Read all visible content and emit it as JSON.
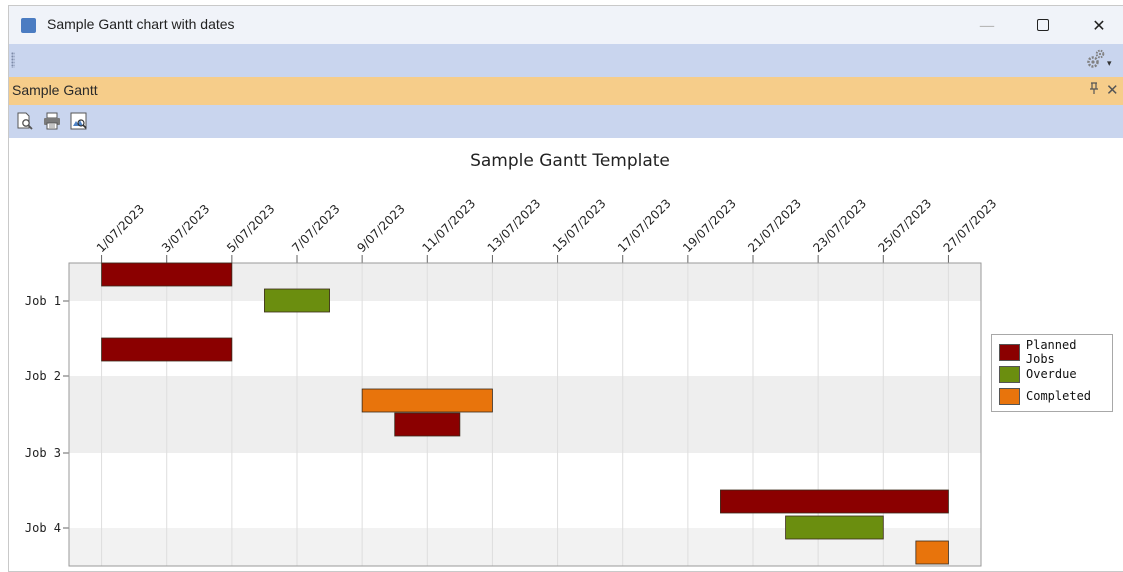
{
  "window": {
    "title": "Sample Gantt chart with dates",
    "minimize_glyph": "—",
    "close_glyph": "✕"
  },
  "toolbar": {
    "settings_icon": "gear-icon",
    "settings_dropdown_glyph": "▾"
  },
  "panel": {
    "title": "Sample Gantt",
    "pin_glyph": "ⵖ",
    "close_glyph": "✕"
  },
  "panel_toolbar": {
    "buttons": [
      "print-preview-icon",
      "print-icon",
      "zoom-preview-icon"
    ]
  },
  "chart_data": {
    "type": "gantt",
    "title": "Sample Gantt Template",
    "x_ticks": [
      "1/07/2023",
      "3/07/2023",
      "5/07/2023",
      "7/07/2023",
      "9/07/2023",
      "11/07/2023",
      "13/07/2023",
      "15/07/2023",
      "17/07/2023",
      "19/07/2023",
      "21/07/2023",
      "23/07/2023",
      "25/07/2023",
      "27/07/2023"
    ],
    "xlim": [
      "2023-06-30",
      "2023-07-28"
    ],
    "categories": [
      "Job 1",
      "Job 2",
      "Job 3",
      "Job 4"
    ],
    "legend_position": "right",
    "grid": true,
    "series": [
      {
        "name": "Planned Jobs",
        "color": "#8b0000",
        "tasks": [
          {
            "job": "Job 1",
            "start": "2023-07-01",
            "end": "2023-07-05"
          },
          {
            "job": "Job 2",
            "start": "2023-07-01",
            "end": "2023-07-05"
          },
          {
            "job": "Job 3",
            "start": "2023-07-10",
            "end": "2023-07-12"
          },
          {
            "job": "Job 4",
            "start": "2023-07-20",
            "end": "2023-07-27"
          }
        ]
      },
      {
        "name": "Overdue",
        "color": "#6b8e0f",
        "tasks": [
          {
            "job": "Job 1",
            "start": "2023-07-06",
            "end": "2023-07-08"
          },
          {
            "job": "Job 4",
            "start": "2023-07-22",
            "end": "2023-07-25"
          }
        ]
      },
      {
        "name": "Completed",
        "color": "#e8740c",
        "tasks": [
          {
            "job": "Job 2",
            "start": "2023-07-09",
            "end": "2023-07-13"
          },
          {
            "job": "Job 4",
            "start": "2023-07-26",
            "end": "2023-07-27"
          }
        ]
      }
    ]
  }
}
